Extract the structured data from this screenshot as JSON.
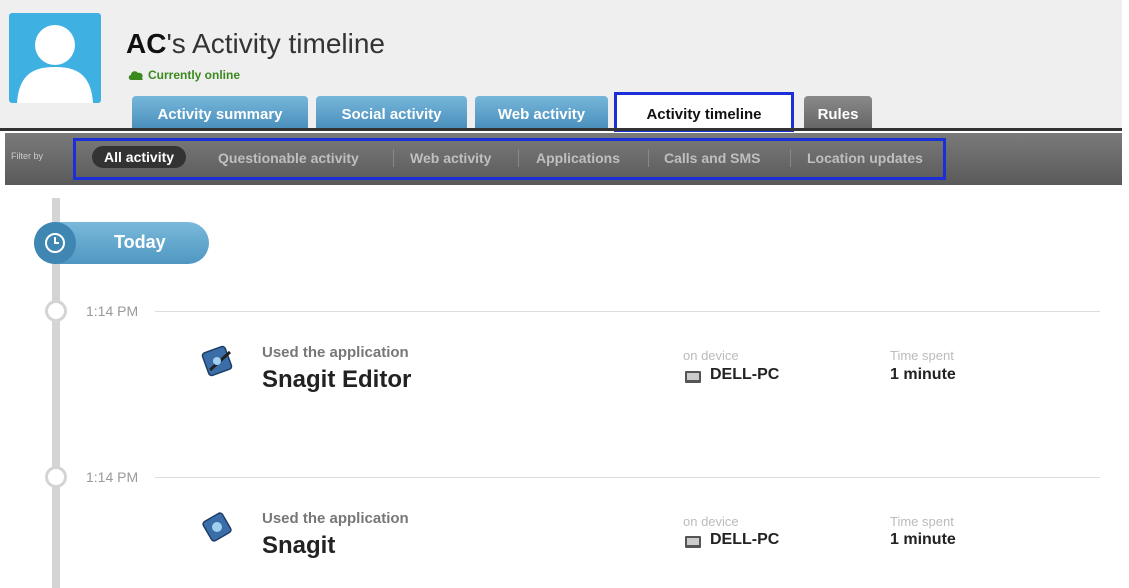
{
  "header": {
    "user_initials": "AC",
    "title_suffix": "'s Activity timeline",
    "status": "Currently online"
  },
  "tabs": [
    {
      "label": "Activity summary"
    },
    {
      "label": "Social activity"
    },
    {
      "label": "Web activity"
    },
    {
      "label": "Activity timeline"
    },
    {
      "label": "Rules"
    }
  ],
  "filter": {
    "label": "Filter by",
    "items": [
      {
        "label": "All activity"
      },
      {
        "label": "Questionable activity"
      },
      {
        "label": "Web activity"
      },
      {
        "label": "Applications"
      },
      {
        "label": "Calls and SMS"
      },
      {
        "label": "Location updates"
      }
    ]
  },
  "timeline": {
    "day_label": "Today",
    "entries": [
      {
        "time": "1:14 PM",
        "action": "Used the application",
        "app": "Snagit Editor",
        "device_label": "on device",
        "device": "DELL-PC",
        "time_spent_label": "Time spent",
        "time_spent": "1 minute"
      },
      {
        "time": "1:14 PM",
        "action": "Used the application",
        "app": "Snagit",
        "device_label": "on device",
        "device": "DELL-PC",
        "time_spent_label": "Time spent",
        "time_spent": "1 minute"
      }
    ]
  },
  "colors": {
    "accent": "#4b90bd",
    "highlight": "#1a2fd8",
    "online": "#3a8a1e"
  }
}
